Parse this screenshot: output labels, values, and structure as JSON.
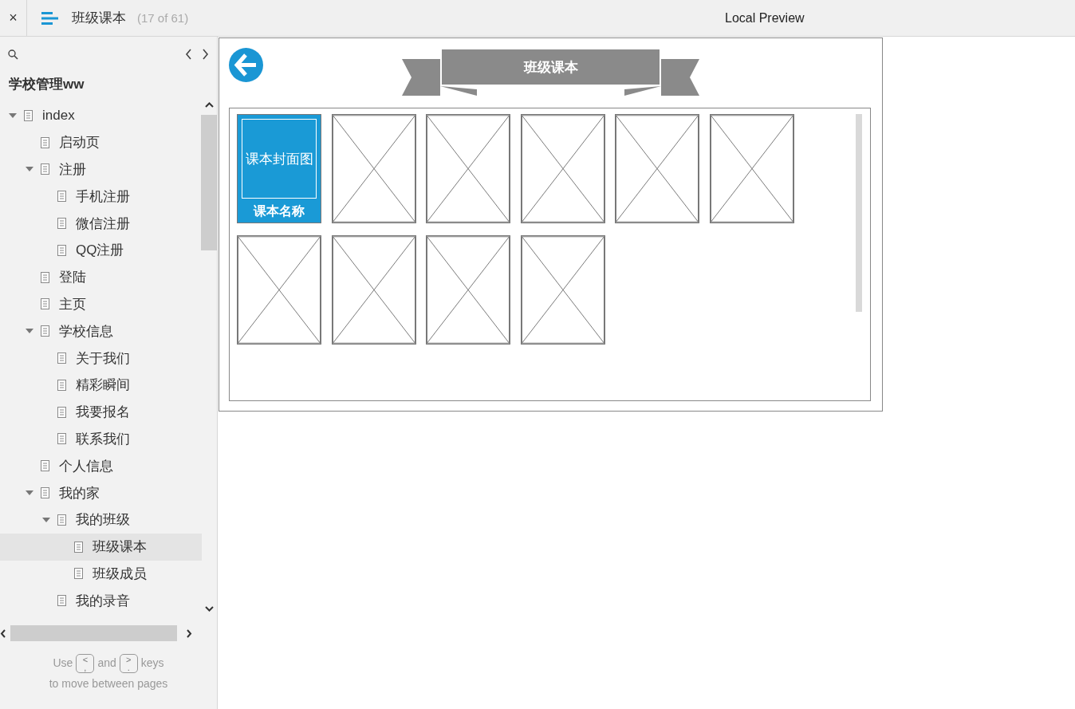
{
  "topbar": {
    "close_label": "×",
    "page_title": "班级课本",
    "page_count": "(17 of 61)",
    "preview_label": "Local Preview"
  },
  "sidebar": {
    "project_title": "学校管理ww",
    "tree": [
      {
        "label": "index",
        "expanded": true,
        "selected": false,
        "children": [
          {
            "label": "启动页",
            "selected": false
          },
          {
            "label": "注册",
            "expanded": true,
            "selected": false,
            "children": [
              {
                "label": "手机注册",
                "selected": false
              },
              {
                "label": "微信注册",
                "selected": false
              },
              {
                "label": "QQ注册",
                "selected": false
              }
            ]
          },
          {
            "label": "登陆",
            "selected": false
          },
          {
            "label": "主页",
            "selected": false
          },
          {
            "label": "学校信息",
            "expanded": true,
            "selected": false,
            "children": [
              {
                "label": "关于我们",
                "selected": false
              },
              {
                "label": "精彩瞬间",
                "selected": false
              },
              {
                "label": "我要报名",
                "selected": false
              },
              {
                "label": "联系我们",
                "selected": false
              }
            ]
          },
          {
            "label": "个人信息",
            "selected": false
          },
          {
            "label": "我的家",
            "expanded": true,
            "selected": false,
            "children": [
              {
                "label": "我的班级",
                "expanded": true,
                "selected": false,
                "children": [
                  {
                    "label": "班级课本",
                    "selected": true
                  },
                  {
                    "label": "班级成员",
                    "selected": false
                  }
                ]
              },
              {
                "label": "我的录音",
                "selected": false
              }
            ]
          }
        ]
      }
    ],
    "hint": {
      "use": "Use",
      "key1_top": "<",
      "key1_bottom": ",",
      "and": "and",
      "key2_top": ">",
      "key2_bottom": ".",
      "keys": "keys",
      "line2": "to move between pages"
    }
  },
  "preview": {
    "banner_title": "班级课本",
    "books": [
      {
        "kind": "cover",
        "cover_text": "课本封面图",
        "name": "课本名称"
      },
      {
        "kind": "placeholder"
      },
      {
        "kind": "placeholder"
      },
      {
        "kind": "placeholder"
      },
      {
        "kind": "placeholder"
      },
      {
        "kind": "placeholder"
      },
      {
        "kind": "placeholder"
      },
      {
        "kind": "placeholder"
      },
      {
        "kind": "placeholder"
      },
      {
        "kind": "placeholder"
      }
    ]
  }
}
